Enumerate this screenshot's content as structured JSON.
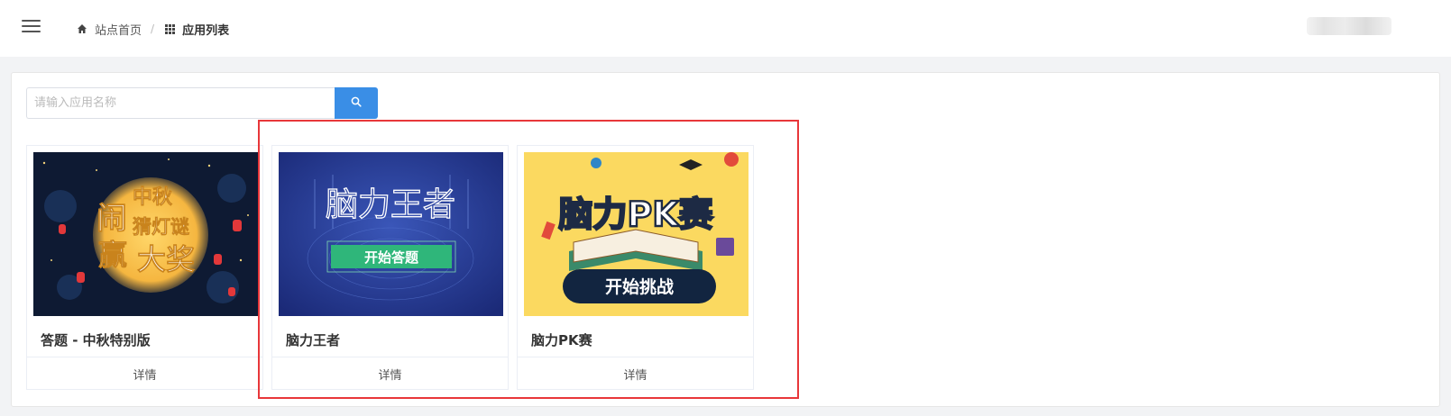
{
  "breadcrumb": {
    "home_label": "站点首页",
    "separator": "/",
    "current_label": "应用列表"
  },
  "search": {
    "placeholder": "请输入应用名称",
    "value": ""
  },
  "apps": [
    {
      "name": "答题 - 中秋特别版",
      "detail_label": "详情",
      "image_text": [
        "闹",
        "中秋",
        "猜灯谜",
        "赢",
        "大奖"
      ]
    },
    {
      "name": "脑力王者",
      "detail_label": "详情",
      "image_text": [
        "脑力王者",
        "开始答题"
      ]
    },
    {
      "name": "脑力PK赛",
      "detail_label": "详情",
      "image_text": [
        "脑力PK赛",
        "开始挑战"
      ]
    }
  ],
  "colors": {
    "accent": "#3a8ee6",
    "highlight_border": "#e8373a",
    "page_bg": "#f2f3f5"
  },
  "icons": [
    "menu-icon",
    "home-icon",
    "grid-icon",
    "search-icon"
  ]
}
